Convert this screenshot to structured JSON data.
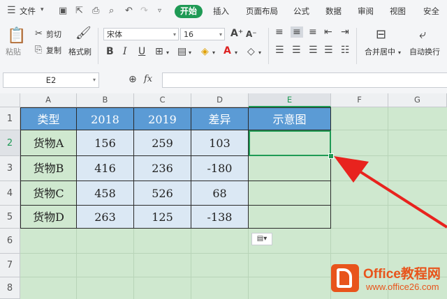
{
  "menubar": {
    "file_label": "文件",
    "tabs": [
      "开始",
      "插入",
      "页面布局",
      "公式",
      "数据",
      "审阅",
      "视图",
      "安全"
    ]
  },
  "ribbon": {
    "paste": "粘贴",
    "cut": "剪切",
    "copy": "复制",
    "format_painter": "格式刷",
    "font_name": "宋体",
    "font_size": "16",
    "merge_center": "合并居中",
    "wrap_text": "自动换行"
  },
  "formula_bar": {
    "name_box": "E2",
    "fx_label": "fx",
    "formula": ""
  },
  "sheet": {
    "columns": [
      "A",
      "B",
      "C",
      "D",
      "E",
      "F",
      "G"
    ],
    "selected_column": "E",
    "rows": [
      "1",
      "2",
      "3",
      "4",
      "5",
      "6",
      "7",
      "8"
    ],
    "selected_row": "2",
    "header_row": [
      "类型",
      "2018",
      "2019",
      "差异",
      "示意图"
    ],
    "data_rows": [
      [
        "货物A",
        "156",
        "259",
        "103",
        ""
      ],
      [
        "货物B",
        "416",
        "236",
        "-180",
        ""
      ],
      [
        "货物C",
        "458",
        "526",
        "68",
        ""
      ],
      [
        "货物D",
        "263",
        "125",
        "-138",
        ""
      ]
    ],
    "paste_options": "▤▾"
  },
  "watermark": {
    "brand": "Office教程网",
    "url": "www.office26.com"
  },
  "colors": {
    "accent": "#1f9a55",
    "header_fill": "#5b9bd5",
    "data_fill": "#dbe8f4",
    "sheet_bg": "#cfe8cf",
    "arrow": "#e8231e",
    "logo": "#e8541b"
  }
}
